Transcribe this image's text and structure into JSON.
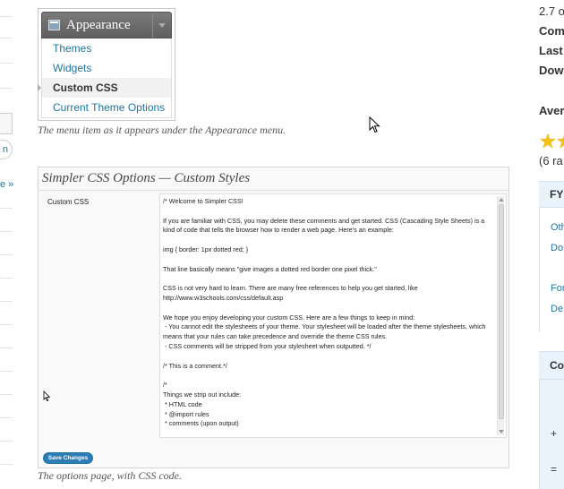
{
  "menu_screenshot": {
    "header_title": "Appearance",
    "items": [
      {
        "label": "Themes",
        "current": false
      },
      {
        "label": "Widgets",
        "current": false
      },
      {
        "label": "Custom CSS",
        "current": true
      },
      {
        "label": "Current Theme Options",
        "current": false
      }
    ],
    "caption": "The menu item as it appears under the Appearance menu."
  },
  "options_screenshot": {
    "title": "Simpler CSS Options — Custom Styles",
    "field_label": "Custom CSS",
    "css_content": "/* Welcome to Simpler CSS!\n\nIf you are familiar with CSS, you may delete these comments and get started. CSS (Cascading Style Sheets) is a kind of code that tells the browser how to render a web page. Here's an example:\n\nimg { border: 1px dotted red; }\n\nThat line basically means \"give images a dotted red border one pixel thick.\"\n\nCSS is not very hard to learn. There are many free references to help you get started, like http://www.w3schools.com/css/default.asp\n\nWe hope you enjoy developing your custom CSS. Here are a few things to keep in mind:\n - You cannot edit the stylesheets of your theme. Your stylesheet will be loaded after the theme stylesheets, which means that your rules can take precedence and override the theme CSS rules.\n - CSS comments will be stripped from your stylesheet when outputted. */\n\n/* This is a comment.*/\n\n/*\nThings we strip out include:\n * HTML code\n * @import rules\n * comments (upon output)",
    "save_label": "Save Changes",
    "caption": "The options page, with CSS code."
  },
  "left_edge": {
    "pill_text": "n",
    "link_text": "e »"
  },
  "sidebar": {
    "version_fragment": "2.7 o",
    "compat_fragment": "Com",
    "last_fragment": "Last",
    "downloads_fragment": "Dow",
    "average_fragment": "Aver",
    "ratings_fragment": "(6 ra",
    "fyi_label": "FY",
    "link_other": "Oth",
    "link_do": "Do",
    "link_for": "For",
    "link_de": "De",
    "compat_box_label": "Co",
    "plus_symbol": "+",
    "equals_symbol": "="
  },
  "colors": {
    "link": "#21759b",
    "star": "#f4c20d",
    "menu_header": "#6d6d6d",
    "sidebar_box": "#eaf2fa"
  }
}
